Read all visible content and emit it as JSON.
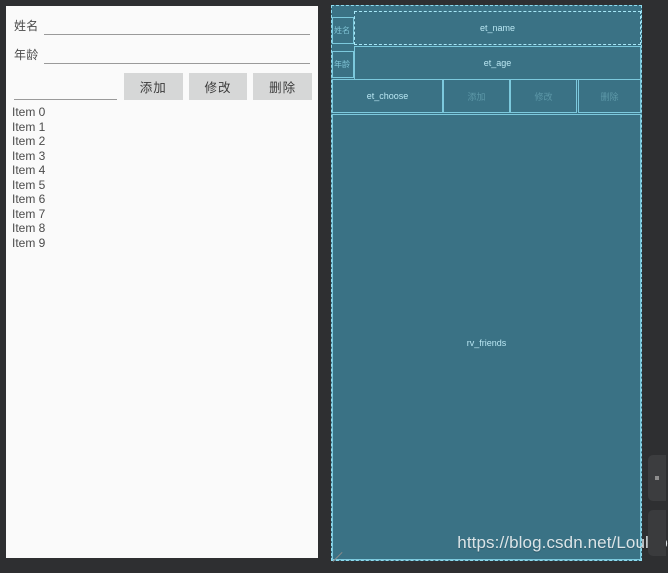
{
  "preview": {
    "name_label": "姓名",
    "age_label": "年龄",
    "name_value": "",
    "name_placeholder": "",
    "age_value": "",
    "age_placeholder": "",
    "choose_value": "",
    "choose_placeholder": "",
    "buttons": [
      {
        "label": "添加",
        "name": "add-button"
      },
      {
        "label": "修改",
        "name": "modify-button"
      },
      {
        "label": "删除",
        "name": "delete-button"
      }
    ],
    "list_items": [
      "Item 0",
      "Item 1",
      "Item 2",
      "Item 3",
      "Item 4",
      "Item 5",
      "Item 6",
      "Item 7",
      "Item 8",
      "Item 9"
    ],
    "background": "#fafafa",
    "button_color": "#d6d7d7"
  },
  "blueprint": {
    "fill_color": "#3a7285",
    "outline_color": "#7cc9dd",
    "selection_color": "#a8e8f8",
    "canvas_background": "#2e2f31",
    "nodes": {
      "name_label": "姓名",
      "age_label": "年龄",
      "et_name": "et_name",
      "et_age": "et_age",
      "et_choose": "et_choose",
      "btn_add": "添加",
      "btn_modify": "修改",
      "btn_delete": "删除",
      "recycler": "rv_friends"
    },
    "watermark": "https://blog.csdn.net/Louloo"
  }
}
